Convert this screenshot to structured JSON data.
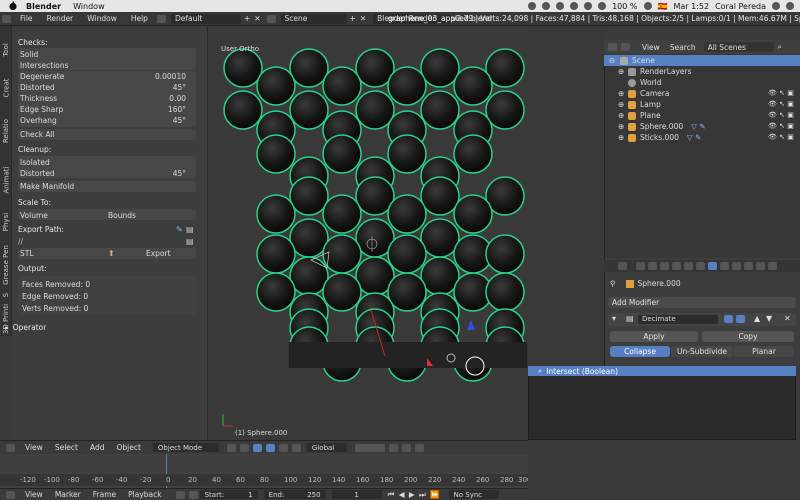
{
  "menubar": {
    "app": "Blender",
    "window": "Window",
    "battery": "100 %",
    "lang_flag": "🇪🇸",
    "clock": "Mar 1:52",
    "user": "Coral Pereda"
  },
  "info": {
    "file": "File",
    "render": "Render",
    "window": "Window",
    "help": "Help",
    "layout": "Default",
    "scene": "Scene",
    "engine": "Blender Render",
    "filename": "graphene_03_applied.blend",
    "stats": "v2.79 | Verts:24,098 | Faces:47,884 | Tris:48,168 | Objects:2/5 | Lamps:0/1 | Mem:46.67M | Sphe..."
  },
  "left_tabs": [
    "Tool",
    "Creat",
    "Relatio",
    "Animati",
    "Physi",
    "Grease Pen",
    "S",
    "3D Printi"
  ],
  "toolpanel": {
    "checks": "Checks:",
    "solid": "Solid",
    "intersections": "Intersections",
    "degenerate_label": "Degenerate",
    "degenerate_val": "0.00010",
    "distorted_label": "Distorted",
    "distorted_val": "45°",
    "thickness_label": "Thickness",
    "thickness_val": "0.00",
    "edge_sharp_label": "Edge Sharp",
    "edge_sharp_val": "160°",
    "overhang_label": "Overhang",
    "overhang_val": "45°",
    "check_all": "Check All",
    "cleanup": "Cleanup:",
    "isolated": "Isolated",
    "distorted2_label": "Distorted",
    "distorted2_val": "45°",
    "make_manifold": "Make Manifold",
    "scale_to": "Scale To:",
    "volume": "Volume",
    "bounds": "Bounds",
    "export_path": "Export Path:",
    "path_val": "//",
    "stl": "STL",
    "export": "Export",
    "output": "Output:",
    "faces_removed": "Faces Removed: 0",
    "edge_removed": "Edge Removed: 0",
    "verts_removed": "Verts Removed: 0",
    "operator": "Operator"
  },
  "viewport": {
    "label": "User Ortho",
    "object": "(1) Sphere.000"
  },
  "outliner": {
    "view": "View",
    "search": "Search",
    "all_scenes": "All Scenes",
    "items": [
      {
        "label": "Scene",
        "color": "#cccccc"
      },
      {
        "label": "RenderLayers",
        "color": "#bbbbbb"
      },
      {
        "label": "World",
        "color": "#bbbbbb"
      },
      {
        "label": "Camera",
        "color": "#e0a040"
      },
      {
        "label": "Lamp",
        "color": "#e0a040"
      },
      {
        "label": "Plane",
        "color": "#e0a040"
      },
      {
        "label": "Sphere.000",
        "color": "#e0a040"
      },
      {
        "label": "Sticks.000",
        "color": "#e0a040"
      }
    ]
  },
  "properties": {
    "object_name": "Sphere.000",
    "add_modifier": "Add Modifier",
    "modifier_name": "Decimate",
    "apply": "Apply",
    "copy": "Copy",
    "collapse": "Collapse",
    "unsubdivide": "Un-Subdivide",
    "planar": "Planar"
  },
  "dropdown": {
    "item": "Intersect (Boolean)"
  },
  "viewport_header": {
    "view": "View",
    "select": "Select",
    "add": "Add",
    "object": "Object",
    "mode": "Object Mode",
    "global": "Global"
  },
  "timeline": {
    "ticks": [
      "-120",
      "-100",
      "-80",
      "-60",
      "-40",
      "-20",
      "0",
      "20",
      "40",
      "60",
      "80",
      "100",
      "120",
      "140",
      "160",
      "180",
      "200",
      "220",
      "240",
      "260",
      "280",
      "300"
    ],
    "view": "View",
    "marker": "Marker",
    "frame": "Frame",
    "playback": "Playback",
    "start": "Start:",
    "start_val": "1",
    "end": "End:",
    "end_val": "250",
    "current": "1",
    "sync": "No Sync"
  }
}
